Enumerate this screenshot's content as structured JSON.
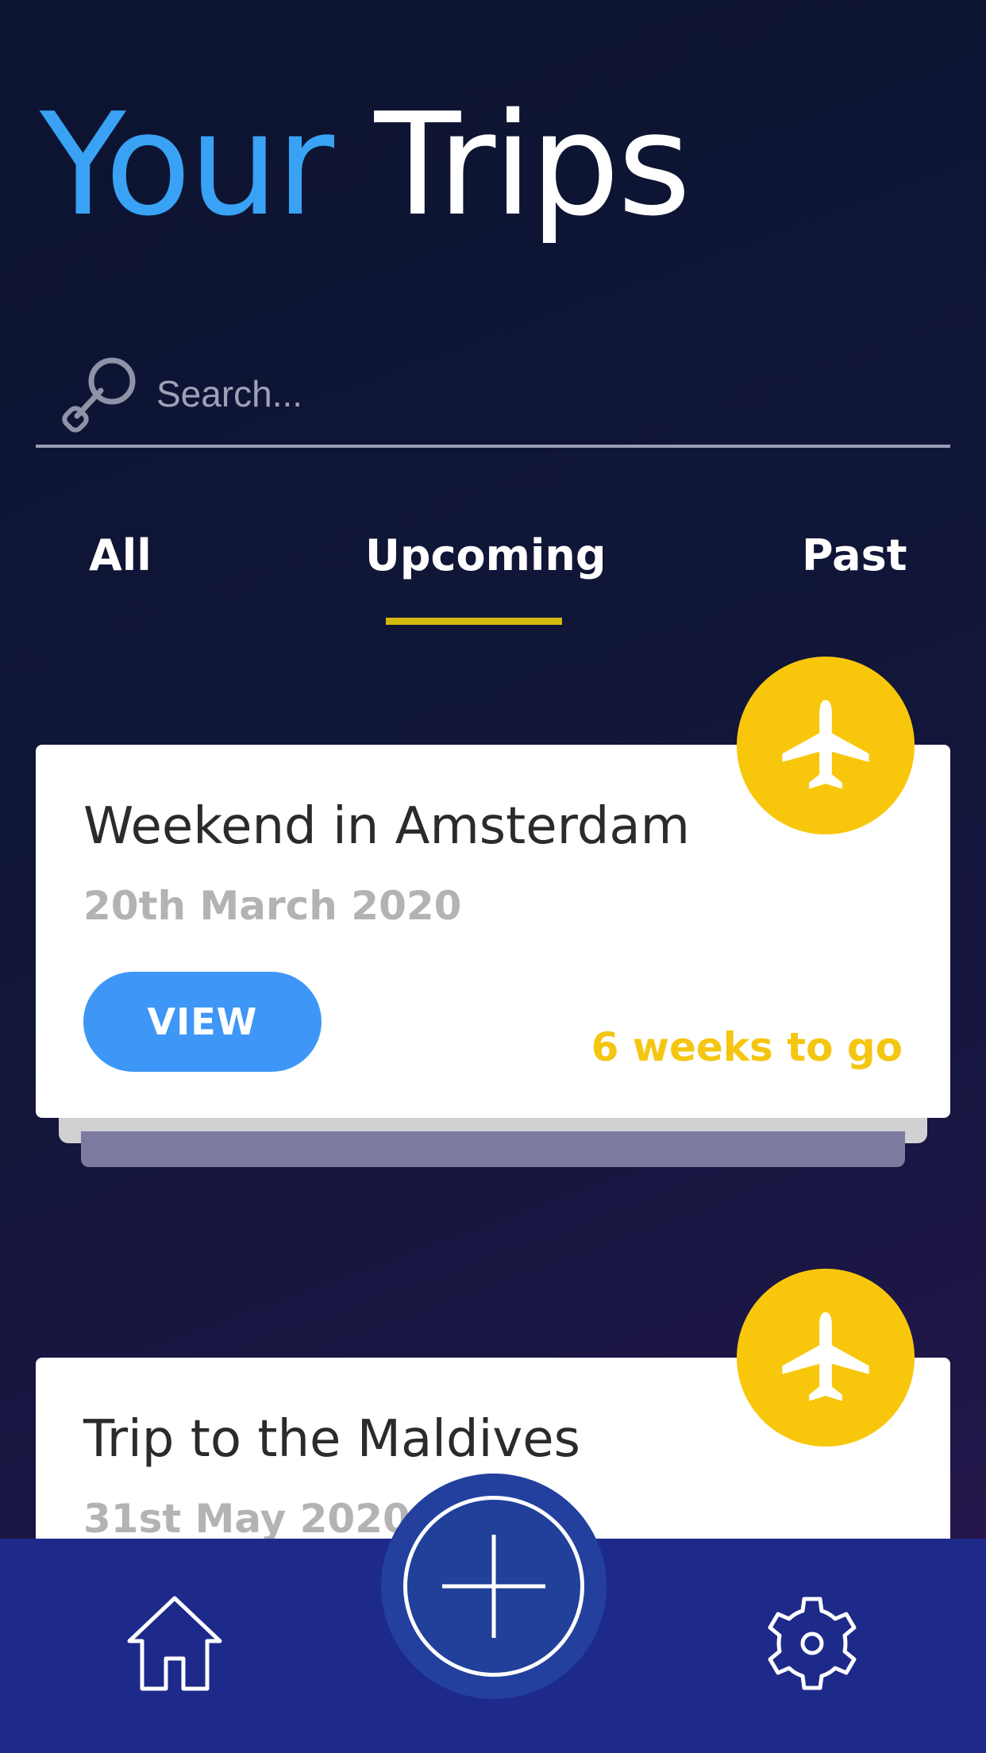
{
  "header": {
    "title_part1": "Your",
    "title_part2": "Trips"
  },
  "search": {
    "placeholder": "Search..."
  },
  "tabs": [
    {
      "label": "All",
      "active": false
    },
    {
      "label": "Upcoming",
      "active": true
    },
    {
      "label": "Past",
      "active": false
    }
  ],
  "trips": [
    {
      "title": "Weekend in Amsterdam",
      "date": "20th March 2020",
      "button_label": "VIEW",
      "countdown": "6 weeks to go",
      "icon": "airplane-icon"
    },
    {
      "title": "Trip to the Maldives",
      "date": "31st May 2020",
      "icon": "airplane-icon"
    }
  ],
  "nav": {
    "home_icon": "home-icon",
    "add_icon": "plus-icon",
    "settings_icon": "gear-icon"
  },
  "colors": {
    "accent_blue": "#3aa2f5",
    "accent_yellow": "#f8c70c",
    "nav_bar": "#1e2a8a",
    "button_blue": "#3e97f7"
  }
}
